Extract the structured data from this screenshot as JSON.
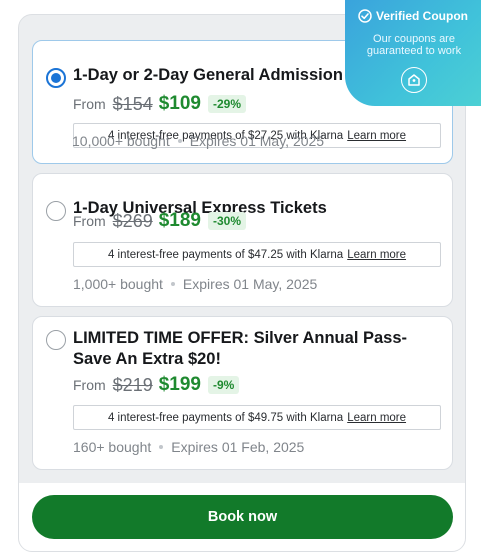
{
  "offers": [
    {
      "title": "1-Day or 2-Day General Admission Tickets",
      "from": "From",
      "old_price": "$154",
      "new_price": "$109",
      "discount": "-29%",
      "klarna_text": "4 interest-free payments of $27.25 with Klarna",
      "klarna_link": "Learn more",
      "bought": "10,000+ bought",
      "expires": "Expires 01 May, 2025",
      "selected": true
    },
    {
      "title": "1-Day Universal Express Tickets",
      "from": "From",
      "old_price": "$269",
      "new_price": "$189",
      "discount": "-30%",
      "klarna_text": "4 interest-free payments of $47.25 with Klarna",
      "klarna_link": "Learn more",
      "bought": "1,000+ bought",
      "expires": "Expires 01 May, 2025",
      "selected": false
    },
    {
      "title": "LIMITED TIME OFFER: Silver Annual Pass- Save An Extra $20!",
      "from": "From",
      "old_price": "$219",
      "new_price": "$199",
      "discount": "-9%",
      "klarna_text": "4 interest-free payments of $49.75 with Klarna",
      "klarna_link": "Learn more",
      "bought": "160+ bought",
      "expires": "Expires 01 Feb, 2025",
      "selected": false
    }
  ],
  "footer": {
    "book_label": "Book now"
  },
  "badge": {
    "title": "Verified Coupon",
    "subtitle": "Our coupons are guaranteed to work"
  },
  "colors": {
    "accent_green": "#127a2a",
    "price_green": "#1f8a30",
    "radio_blue": "#1b74d6",
    "badge_gradient_start": "#3aa3dc",
    "badge_gradient_end": "#4cd0d4"
  }
}
